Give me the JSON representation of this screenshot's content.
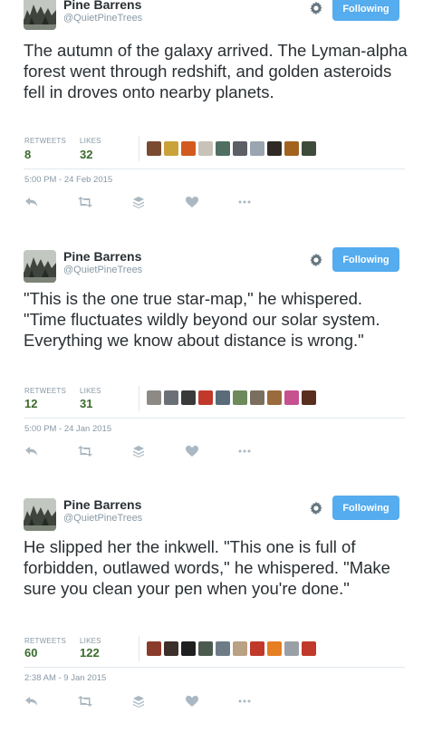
{
  "colors": {
    "accent": "#55acee",
    "stat_value": "#3a6b2d",
    "muted": "#8899a6"
  },
  "icons": {
    "settings": "gear-icon",
    "reply": "reply-icon",
    "retweet": "retweet-icon",
    "stack": "stack-icon",
    "like": "heart-icon",
    "more": "more-icon"
  },
  "tweets": [
    {
      "author_name": "Pine Barrens",
      "author_handle": "@QuietPineTrees",
      "follow_label": "Following",
      "text": "The autumn of the galaxy arrived. The Lyman-alpha forest went through redshift, and golden asteroids fell in droves onto nearby planets.",
      "retweets_label": "RETWEETS",
      "retweets": "8",
      "likes_label": "LIKES",
      "likes": "32",
      "timestamp": "5:00 PM - 24 Feb 2015"
    },
    {
      "author_name": "Pine Barrens",
      "author_handle": "@QuietPineTrees",
      "follow_label": "Following",
      "text": "\"This is the one true star-map,\" he whispered. \"Time fluctuates wildly beyond our solar system. Everything we know about distance is wrong.\"",
      "retweets_label": "RETWEETS",
      "retweets": "12",
      "likes_label": "LIKES",
      "likes": "31",
      "timestamp": "5:00 PM - 24 Jan 2015"
    },
    {
      "author_name": "Pine Barrens",
      "author_handle": "@QuietPineTrees",
      "follow_label": "Following",
      "text": "He slipped her the inkwell. \"This one is full of forbidden, outlawed words,\" he whispered. \"Make sure you clean your pen when you're done.\"",
      "retweets_label": "RETWEETS",
      "retweets": "60",
      "likes_label": "LIKES",
      "likes": "122",
      "timestamp": "2:38 AM - 9 Jan 2015"
    }
  ]
}
